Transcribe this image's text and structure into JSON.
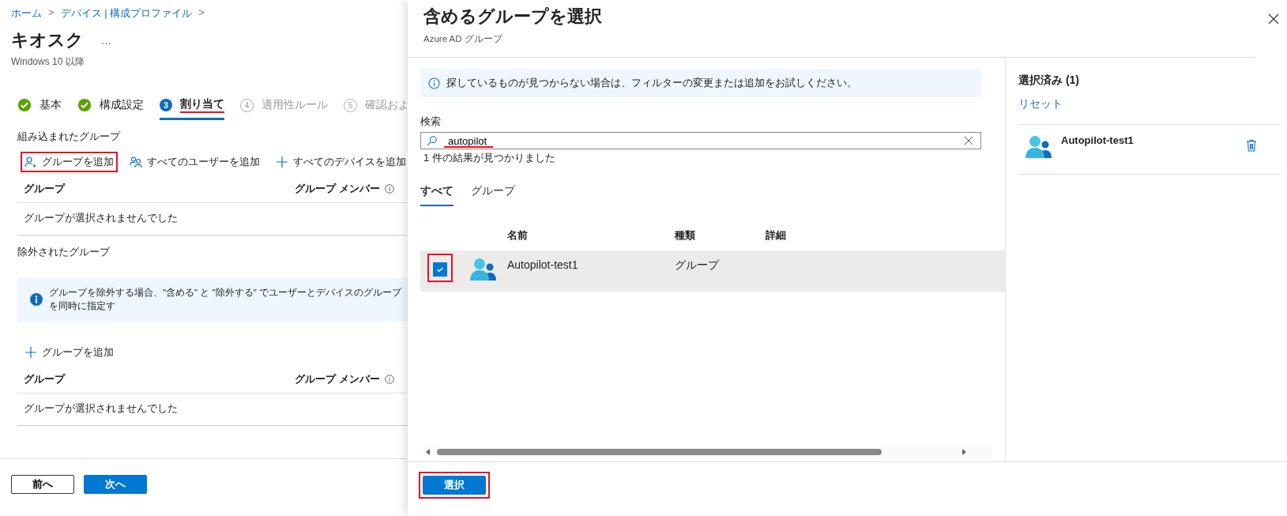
{
  "page": {
    "breadcrumb": [
      {
        "label": "ホーム",
        "separator": ">"
      },
      {
        "label": "デバイス | 構成プロファイル",
        "separator": ">"
      }
    ],
    "title": "キオスク",
    "more": "…",
    "subtitle": "Windows 10 以降",
    "steps": [
      {
        "kind": "done",
        "label": "基本",
        "selected": false,
        "annotated": false
      },
      {
        "kind": "done",
        "label": "構成設定",
        "selected": false,
        "annotated": false
      },
      {
        "kind": "current",
        "number": "3",
        "label": "割り当て",
        "selected": true,
        "annotated": true
      },
      {
        "kind": "pending",
        "number": "4",
        "label": "適用性ルール",
        "selected": false,
        "annotated": false
      },
      {
        "kind": "pending",
        "number": "5",
        "label": "確認およ",
        "selected": false,
        "annotated": false
      }
    ],
    "included": {
      "heading": "組み込まれたグループ",
      "actions": [
        {
          "kind": "person",
          "label": "グループを追加",
          "annotated": true
        },
        {
          "kind": "people",
          "label": "すべてのユーザーを追加",
          "annotated": false
        },
        {
          "kind": "plus",
          "label": "すべてのデバイスを追加",
          "annotated": false
        }
      ],
      "columns": [
        "グループ",
        "グループ メンバー"
      ],
      "empty": "グループが選択されませんでした"
    },
    "excluded": {
      "heading": "除外されたグループ",
      "banner": "グループを除外する場合、\"含める\" と \"除外する\" でユーザーとデバイスのグループを同時に指定す",
      "actions": [
        {
          "kind": "plus",
          "label": "グループを追加",
          "annotated": false
        }
      ],
      "columns": [
        "グループ",
        "グループ メンバー"
      ],
      "empty": "グループが選択されませんでした"
    },
    "footer": [
      "前へ",
      "次へ"
    ]
  },
  "panel": {
    "title": "含めるグループを選択",
    "subtitle": "Azure AD グループ",
    "banner": "探しているものが見つからない場合は、フィルターの変更または追加をお試しください。",
    "search": {
      "label": "検索",
      "value": "autopilot",
      "annotated": true
    },
    "result_count": "1 件の結果が見つかりました",
    "tabs": [
      {
        "label": "すべて",
        "selected": true
      },
      {
        "label": "グループ",
        "selected": false
      }
    ],
    "columns": [
      "名前",
      "種類",
      "詳細"
    ],
    "rows": [
      {
        "name": "Autopilot-test1",
        "type": "グループ",
        "checked": true,
        "selected": true,
        "annotated": true
      }
    ],
    "select_button": {
      "label": "選択",
      "annotated": true
    },
    "selected": {
      "heading": "選択済み (1)",
      "reset": "リセット",
      "items": [
        {
          "name": "Autopilot-test1"
        }
      ]
    }
  }
}
